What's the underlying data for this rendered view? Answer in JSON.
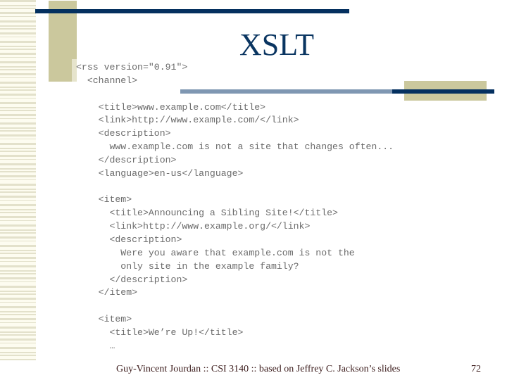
{
  "slide": {
    "title": "XSLT",
    "code_lines": [
      "<rss version=\"0.91\">",
      "  <channel>",
      "",
      "    <title>www.example.com</title>",
      "    <link>http://www.example.com/</link>",
      "    <description>",
      "      www.example.com is not a site that changes often...",
      "    </description>",
      "    <language>en-us</language>",
      "",
      "    <item>",
      "      <title>Announcing a Sibling Site!</title>",
      "      <link>http://www.example.org/</link>",
      "      <description>",
      "        Were you aware that example.com is not the",
      "        only site in the example family?",
      "      </description>",
      "    </item>",
      "",
      "    <item>",
      "      <title>We’re Up!</title>",
      "      …"
    ],
    "footer": {
      "credit": "Guy-Vincent Jourdan :: CSI 3140 :: based on Jeffrey C. Jackson’s slides",
      "page_number": "72"
    }
  },
  "colors": {
    "navy": "#04305f",
    "khaki": "#cbc89d",
    "steel_blue": "#7f97b2",
    "title": "#0a3561"
  }
}
